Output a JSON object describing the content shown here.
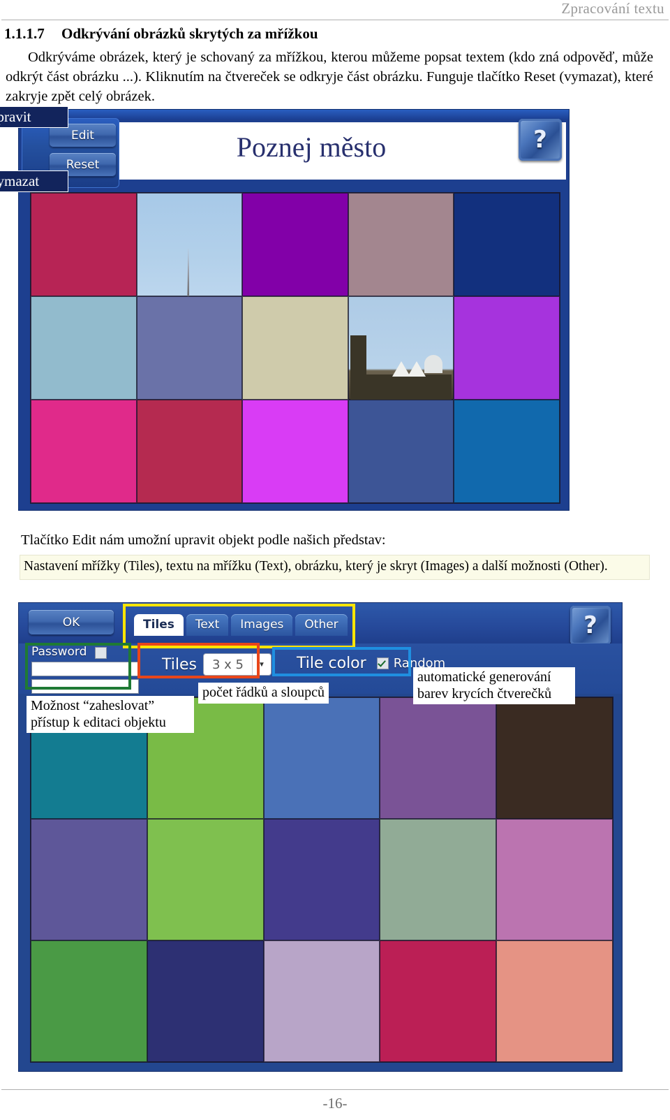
{
  "header": {
    "running_title": "Zpracování textu"
  },
  "section": {
    "number": "1.1.1.7",
    "title": "Odkrývání obrázků skrytých za mřížkou"
  },
  "paragraphs": {
    "intro": "Odkrýváme obrázek, který je schovaný za mřížkou, kterou můžeme popsat textem (kdo zná odpověď, může odkrýt část obrázku ...). Kliknutím na čtvereček se odkryje část obrázku. Funguje tlačítko Reset (vymazat), které zakryje zpět celý obrázek.",
    "mid_lead": "Tlačítko Edit nám umožní upravit objekt podle našich představ:",
    "mid_note": "Nastavení mřížky (Tiles), textu na mřížku (Text), obrázku, který je skryt (Images) a další možnosti (Other)."
  },
  "app1": {
    "title": "Poznej město",
    "buttons": {
      "edit": "Edit",
      "reset": "Reset",
      "help": "?"
    },
    "callouts": {
      "edit_note": "upravit",
      "reset_note": "vymazat"
    },
    "grid": {
      "rows": 3,
      "cols": 5,
      "tiles": [
        {
          "color": "#b72455",
          "revealed": false
        },
        {
          "color": "#aecce8",
          "revealed": true,
          "photo": "sky-with-spire"
        },
        {
          "color": "#8200a8",
          "revealed": false
        },
        {
          "color": "#a3868f",
          "revealed": false
        },
        {
          "color": "#12307e",
          "revealed": false
        },
        {
          "color": "#92bbcd",
          "revealed": false
        },
        {
          "color": "#6a72a8",
          "revealed": false
        },
        {
          "color": "#cfcbab",
          "revealed": false
        },
        {
          "color": "#b0cde6",
          "revealed": true,
          "photo": "gothic-cathedral"
        },
        {
          "color": "#a633dd",
          "revealed": false
        },
        {
          "color": "#e02a8a",
          "revealed": false
        },
        {
          "color": "#b52a50",
          "revealed": false
        },
        {
          "color": "#d93cf5",
          "revealed": false
        },
        {
          "color": "#3d5596",
          "revealed": false
        },
        {
          "color": "#1169ad",
          "revealed": false
        }
      ]
    }
  },
  "app2": {
    "buttons": {
      "ok": "OK",
      "help": "?"
    },
    "tabs": [
      {
        "label": "Tiles",
        "active": true
      },
      {
        "label": "Text",
        "active": false
      },
      {
        "label": "Images",
        "active": false
      },
      {
        "label": "Other",
        "active": false
      }
    ],
    "password": {
      "label": "Password",
      "checked": false,
      "field1_value": "",
      "field2_value": ""
    },
    "tiles_setting": {
      "label": "Tiles",
      "value": "3 x 5",
      "arrow": "▼"
    },
    "tile_color": {
      "label": "Tile color",
      "random_label": "Random",
      "random_checked": true
    },
    "callouts": {
      "password_note_line1": "Možnost “zaheslovat”",
      "password_note_line2": "přístup k editaci objektu",
      "tiles_note": "počet řádků a sloupců",
      "color_note_line1": "automatické generování",
      "color_note_line2": "barev krycích čtverečků"
    },
    "highlight_colors": {
      "tabs": "#ffe500",
      "password": "#1f7a34",
      "tiles": "#e8461a",
      "tile_color": "#1f8fe0"
    },
    "grid": {
      "rows": 3,
      "cols": 5,
      "tiles": [
        {
          "color": "#137c91"
        },
        {
          "color": "#79bb46"
        },
        {
          "color": "#4a71b7"
        },
        {
          "color": "#7a5396"
        },
        {
          "color": "#3a2b22"
        },
        {
          "color": "#5e5799"
        },
        {
          "color": "#7fc04f"
        },
        {
          "color": "#433b8c"
        },
        {
          "color": "#91ab96"
        },
        {
          "color": "#bb74b0"
        },
        {
          "color": "#4a9a45"
        },
        {
          "color": "#2d3073"
        },
        {
          "color": "#b8a5c8"
        },
        {
          "color": "#bb1f55"
        },
        {
          "color": "#e59384"
        }
      ]
    }
  },
  "footer": {
    "page_number": "-16-"
  }
}
